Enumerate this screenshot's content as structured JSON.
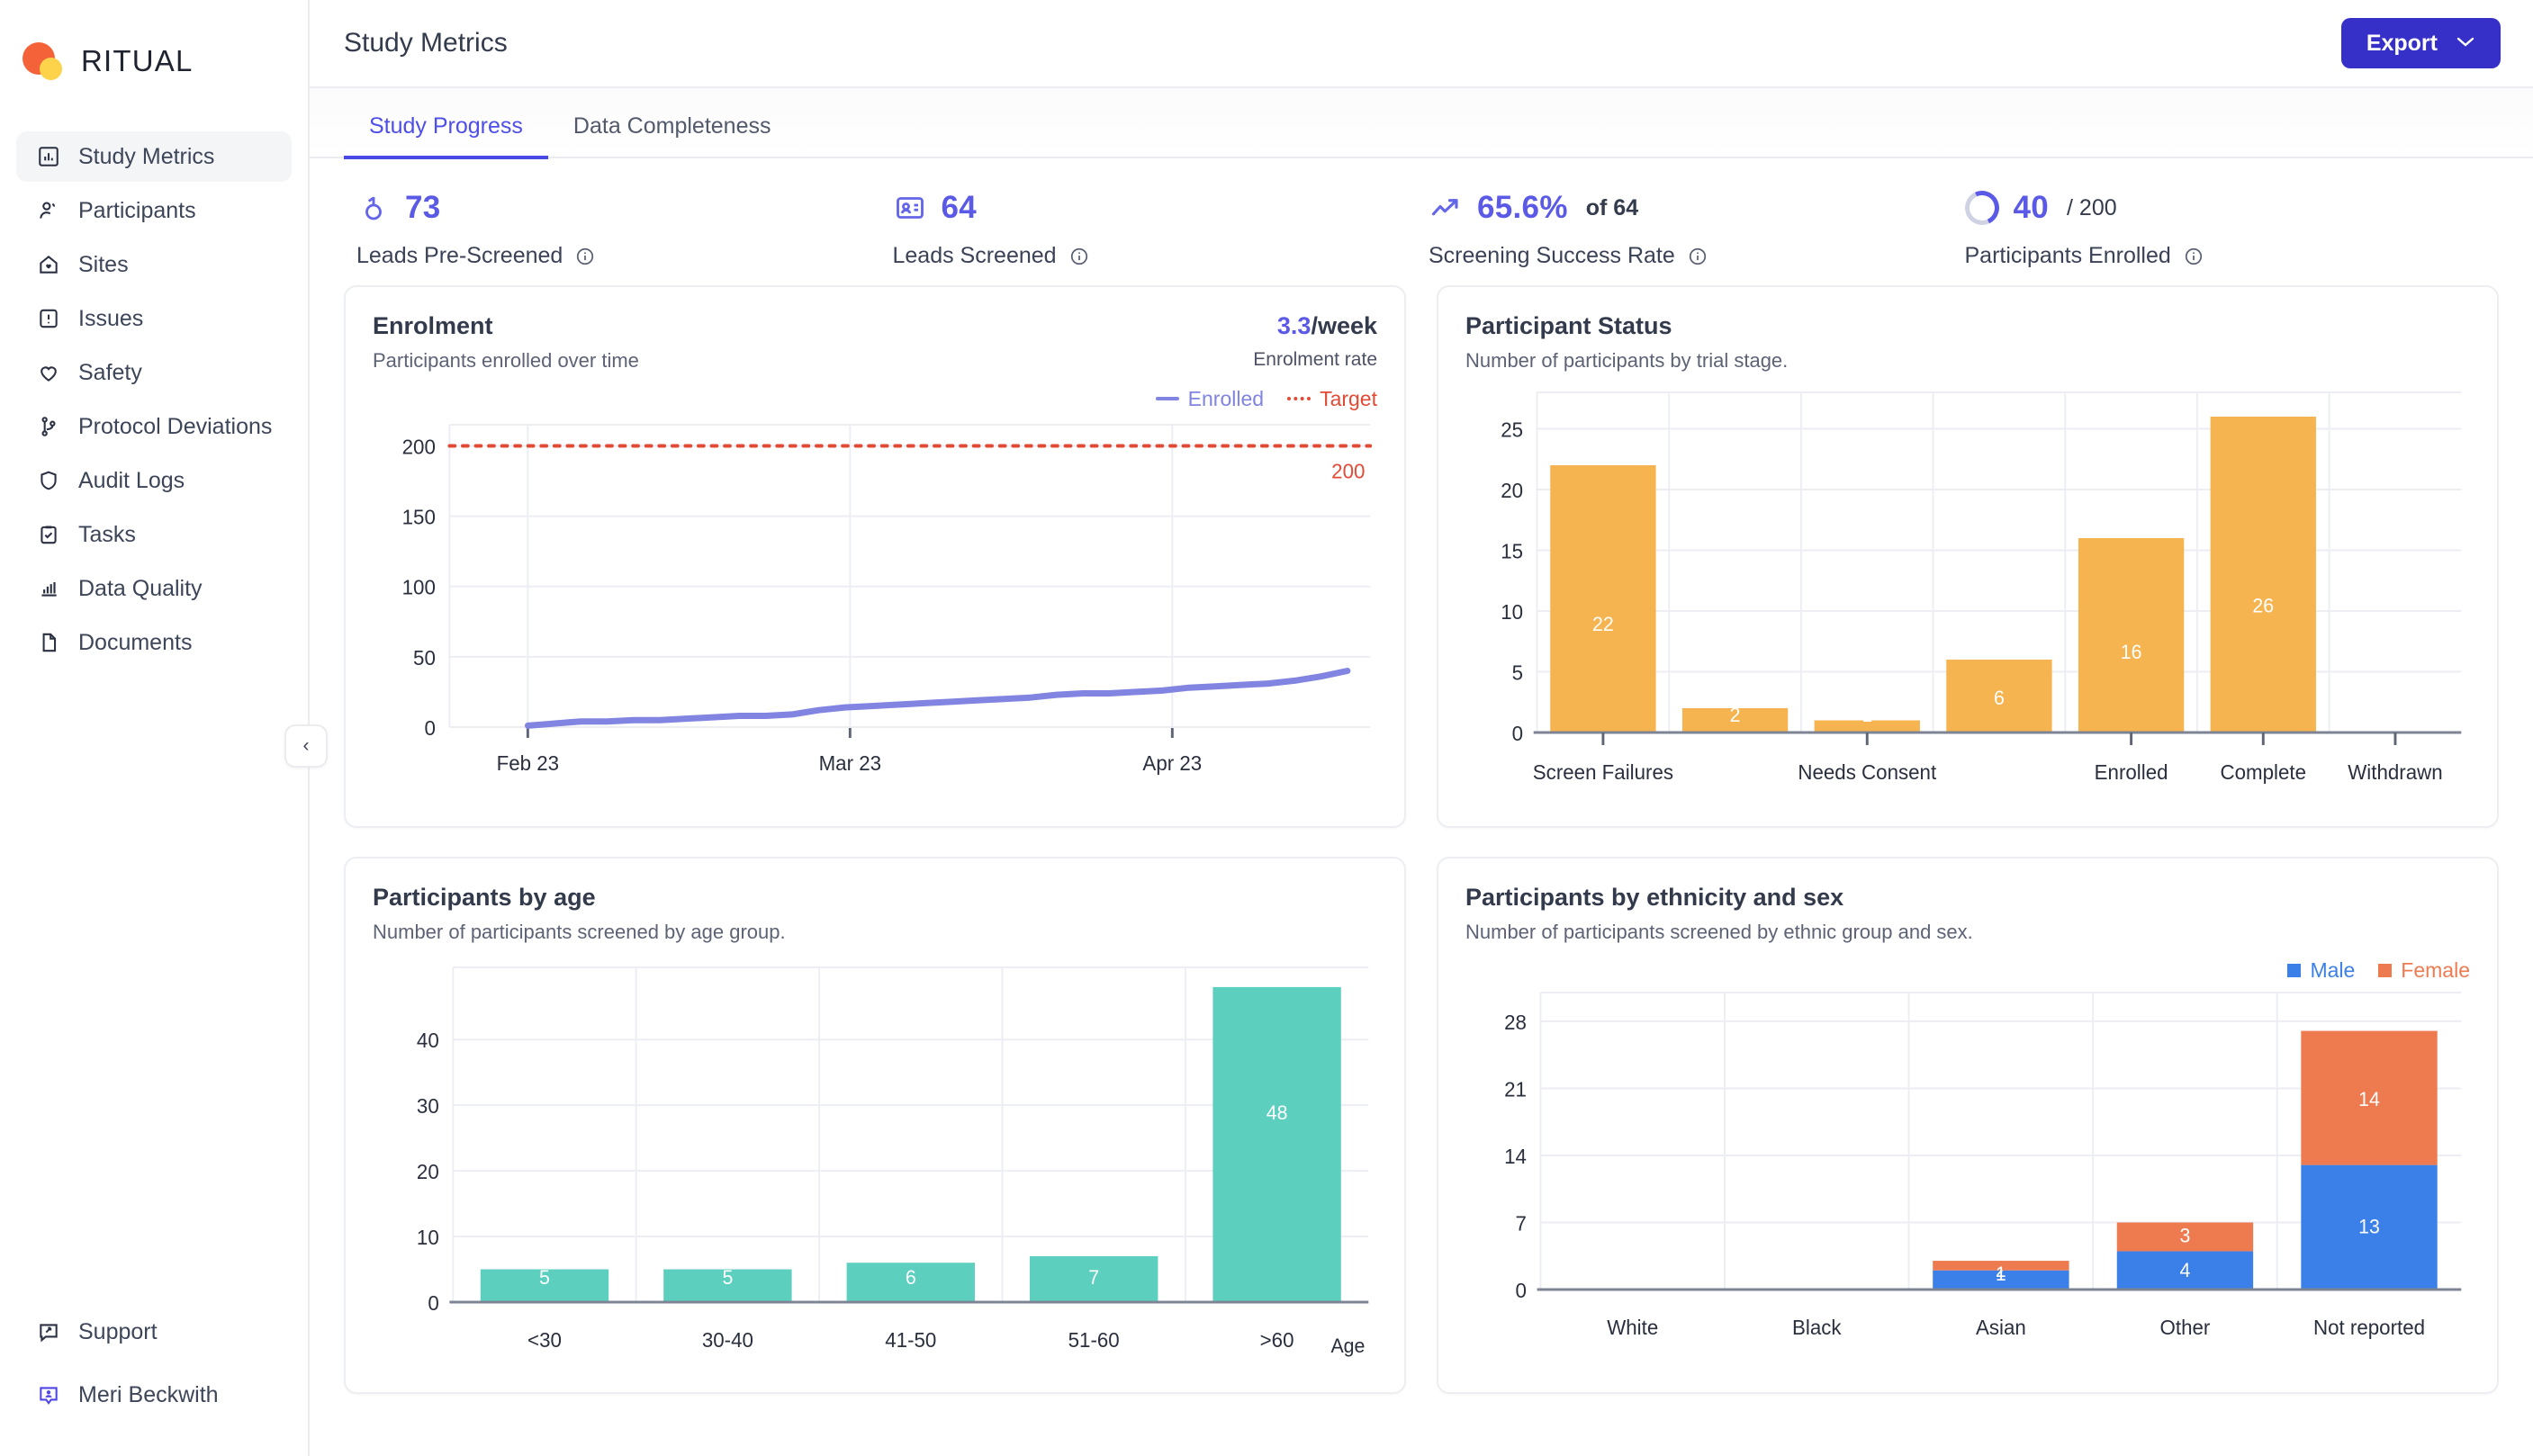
{
  "brand": {
    "name": "RITUAL"
  },
  "sidebar": {
    "items": [
      {
        "label": "Study Metrics",
        "icon": "bar-chart-box-icon",
        "active": true
      },
      {
        "label": "Participants",
        "icon": "user-icon",
        "active": false
      },
      {
        "label": "Sites",
        "icon": "home-heart-icon",
        "active": false
      },
      {
        "label": "Issues",
        "icon": "alert-square-icon",
        "active": false
      },
      {
        "label": "Safety",
        "icon": "heart-icon",
        "active": false
      },
      {
        "label": "Protocol Deviations",
        "icon": "git-branch-icon",
        "active": false
      },
      {
        "label": "Audit Logs",
        "icon": "shield-icon",
        "active": false
      },
      {
        "label": "Tasks",
        "icon": "clipboard-check-icon",
        "active": false
      },
      {
        "label": "Data Quality",
        "icon": "bar-chart-icon",
        "active": false
      },
      {
        "label": "Documents",
        "icon": "document-icon",
        "active": false
      }
    ],
    "bottom_items": [
      {
        "label": "Support",
        "icon": "support-message-icon"
      },
      {
        "label": "Meri Beckwith",
        "icon": "user-badge-icon"
      }
    ],
    "collapse_glyph": "‹"
  },
  "header": {
    "title": "Study Metrics",
    "export_label": "Export",
    "export_chevron": "⌄"
  },
  "tabs": [
    {
      "label": "Study Progress",
      "active": true
    },
    {
      "label": "Data Completeness",
      "active": false
    }
  ],
  "kpis": [
    {
      "icon": "screening-person-icon",
      "value": "73",
      "suffix": "",
      "suffix_light": "",
      "label": "Leads Pre-Screened"
    },
    {
      "icon": "id-card-icon",
      "value": "64",
      "suffix": "",
      "suffix_light": "",
      "label": "Leads Screened"
    },
    {
      "icon": "trend-up-icon",
      "value": "65.6%",
      "suffix": "of 64",
      "suffix_light": "of 64",
      "label": "Screening Success Rate"
    },
    {
      "icon": "donut-progress-icon",
      "value": "40",
      "suffix": "/ 200",
      "suffix_light": "/ 200",
      "label": "Participants Enrolled"
    }
  ],
  "cards": {
    "enrolment": {
      "title": "Enrolment",
      "subtitle": "Participants enrolled over time",
      "metric_value": "3.3",
      "metric_unit": "/week",
      "metric_label": "Enrolment rate"
    },
    "participant_status": {
      "title": "Participant Status",
      "subtitle": "Number of participants by trial stage."
    },
    "participants_by_age": {
      "title": "Participants by age",
      "subtitle": "Number of participants screened by age group."
    },
    "participants_by_ethnicity": {
      "title": "Participants by ethnicity and sex",
      "subtitle": "Number of participants screened by ethnic group and sex."
    }
  },
  "colors": {
    "brand_purple": "#3730c8",
    "accent_indigo": "#5b5ae6",
    "line_purple": "#8184e0",
    "target_red": "#e14a35",
    "bar_orange": "#f5b44f",
    "bar_teal": "#5ccfbf",
    "male_blue": "#3b7fe8",
    "female_orange": "#ee7b50",
    "logo_orange": "#f4623a",
    "logo_yellow": "#fcd34a"
  },
  "chart_data": [
    {
      "id": "enrolment",
      "type": "line",
      "title": "Enrolment",
      "subtitle": "Participants enrolled over time",
      "xlabel": "",
      "ylabel": "",
      "ylim": [
        0,
        215
      ],
      "yticks": [
        0,
        50,
        100,
        150,
        200
      ],
      "xticks": [
        "Feb 23",
        "Mar 23",
        "Apr 23"
      ],
      "grid": true,
      "legend": [
        "Enrolled",
        "Target"
      ],
      "legend_position": "top-right",
      "target": {
        "value": 200,
        "label": "200",
        "style": "dotted",
        "color": "#e14a35"
      },
      "series": [
        {
          "name": "Enrolled",
          "color": "#8184e0",
          "x": [
            0,
            2,
            4,
            6,
            9,
            12,
            15,
            18,
            21,
            24,
            27,
            30,
            33,
            36,
            39,
            42,
            45,
            48,
            51,
            54,
            57,
            60,
            63,
            66,
            69,
            72,
            75,
            78,
            81,
            84,
            87,
            90,
            93
          ],
          "values": [
            1,
            2,
            3,
            4,
            4,
            5,
            5,
            6,
            7,
            8,
            8,
            9,
            12,
            14,
            15,
            16,
            17,
            18,
            19,
            20,
            21,
            23,
            24,
            24,
            25,
            26,
            28,
            29,
            30,
            31,
            33,
            36,
            40
          ]
        }
      ]
    },
    {
      "id": "participant_status",
      "type": "bar",
      "title": "Participant Status",
      "subtitle": "Number of participants by trial stage.",
      "categories": [
        "Screen Failures",
        "",
        "Needs Consent",
        "",
        "Enrolled",
        "Complete",
        "Withdrawn"
      ],
      "tick_labels": [
        "Screen Failures",
        "Needs Consent",
        "Enrolled",
        "Complete",
        "Withdrawn"
      ],
      "values": [
        22,
        2,
        1,
        6,
        16,
        26,
        0
      ],
      "bar_labels": [
        "22",
        "2",
        "1",
        "6",
        "16",
        "26",
        ""
      ],
      "color": "#f5b44f",
      "ylim": [
        0,
        28
      ],
      "yticks": [
        0,
        5,
        10,
        15,
        20,
        25
      ],
      "xlabel": "",
      "ylabel": "",
      "grid": true
    },
    {
      "id": "participants_by_age",
      "type": "bar",
      "title": "Participants by age",
      "subtitle": "Number of participants screened by age group.",
      "categories": [
        "<30",
        "30-40",
        "41-50",
        "51-60",
        ">60"
      ],
      "values": [
        5,
        5,
        6,
        7,
        48
      ],
      "bar_labels": [
        "5",
        "5",
        "6",
        "7",
        "48"
      ],
      "color": "#5ccfbf",
      "ylim": [
        0,
        51
      ],
      "yticks": [
        0,
        10,
        20,
        30,
        40
      ],
      "xlabel": "Age",
      "ylabel": "",
      "grid": true
    },
    {
      "id": "participants_by_ethnicity",
      "type": "bar",
      "subtype": "stacked",
      "title": "Participants by ethnicity and sex",
      "subtitle": "Number of participants screened by ethnic group and sex.",
      "categories": [
        "White",
        "Black",
        "Asian",
        "Other",
        "Not reported"
      ],
      "series": [
        {
          "name": "Male",
          "color": "#3b7fe8",
          "values": [
            0,
            0,
            2,
            4,
            13
          ]
        },
        {
          "name": "Female",
          "color": "#ee7b50",
          "values": [
            0,
            0,
            1,
            3,
            14
          ]
        }
      ],
      "ylim": [
        0,
        31
      ],
      "yticks": [
        0,
        7,
        14,
        21,
        28
      ],
      "xlabel": "",
      "ylabel": "",
      "grid": true,
      "legend": [
        "Male",
        "Female"
      ],
      "legend_position": "top-right"
    }
  ]
}
